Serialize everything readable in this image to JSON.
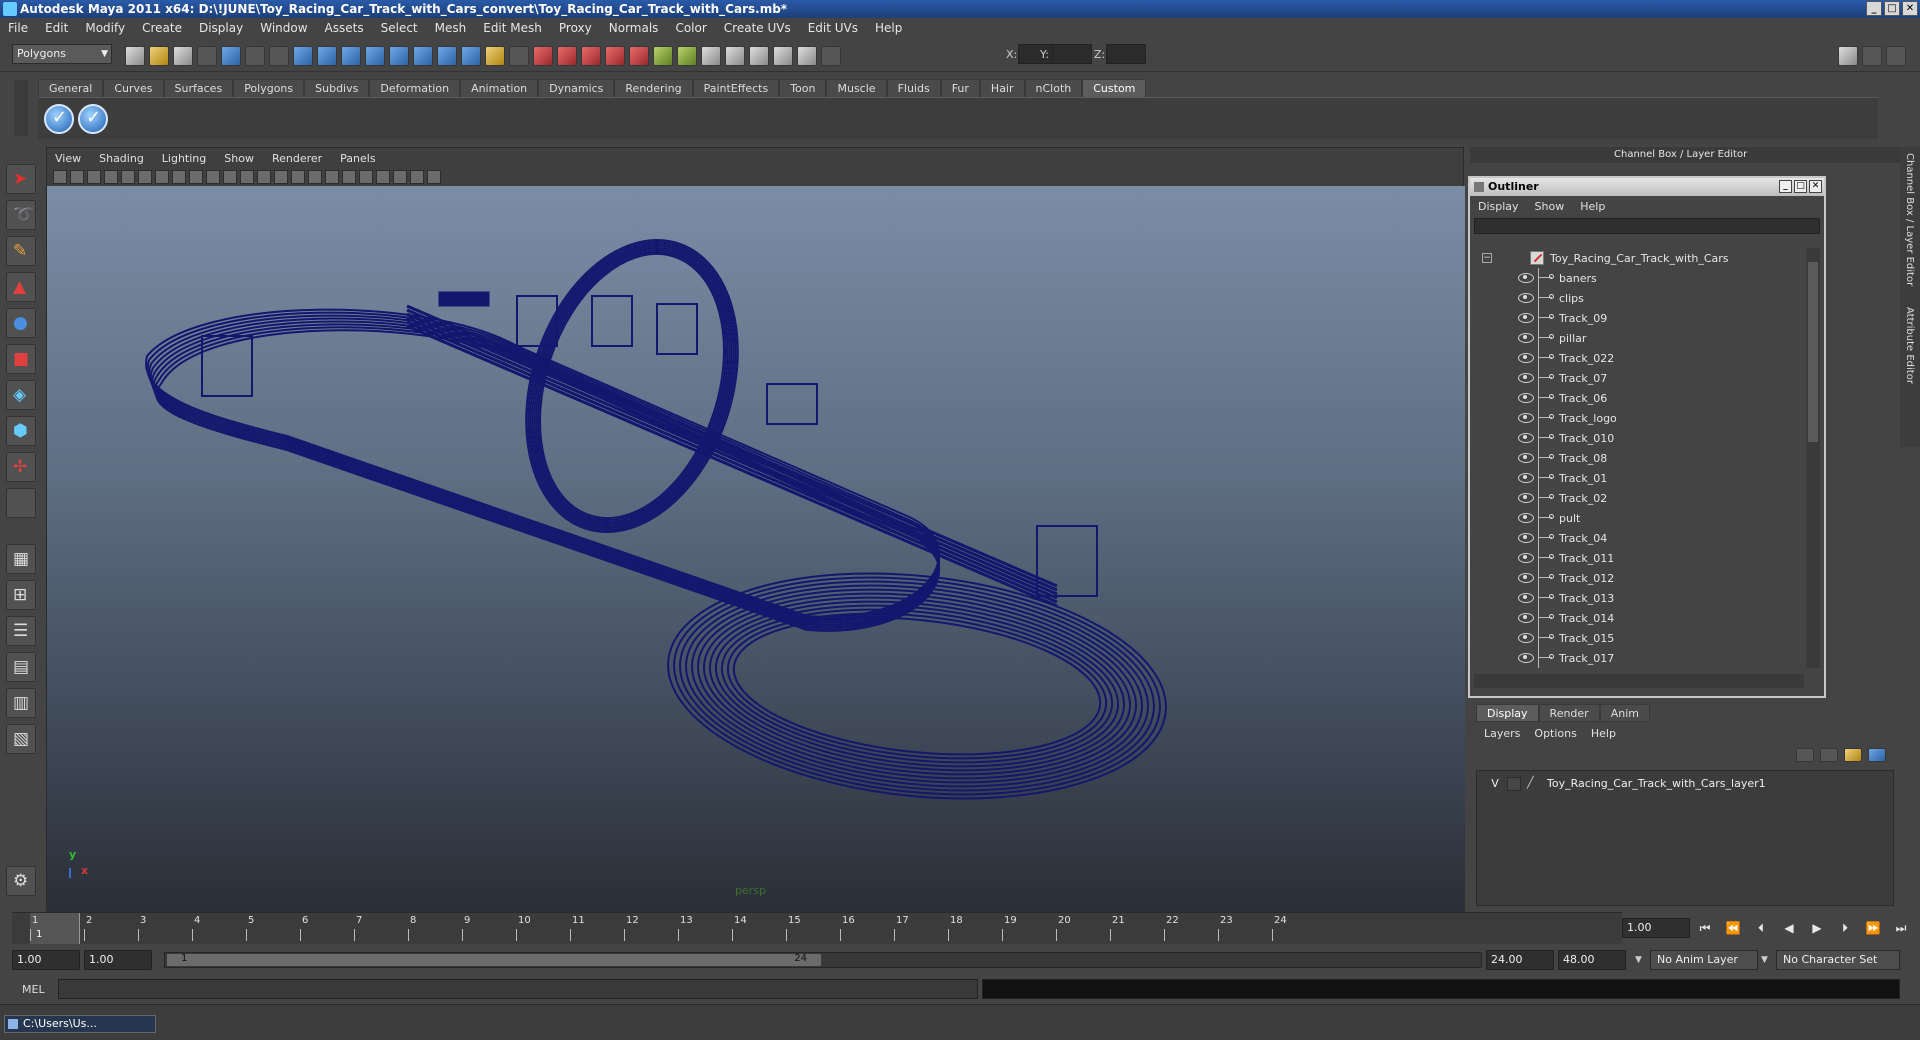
{
  "window": {
    "title": "Autodesk Maya 2011 x64: D:\\!JUNE\\Toy_Racing_Car_Track_with_Cars_convert\\Toy_Racing_Car_Track_with_Cars.mb*",
    "minimize": "_",
    "maximize": "□",
    "close": "✕"
  },
  "menu": [
    "File",
    "Edit",
    "Modify",
    "Create",
    "Display",
    "Window",
    "Assets",
    "Select",
    "Mesh",
    "Edit Mesh",
    "Proxy",
    "Normals",
    "Color",
    "Create UVs",
    "Edit UVs",
    "Help"
  ],
  "status_line": {
    "mode": "Polygons",
    "x_label": "X:",
    "y_label": "Y:",
    "z_label": "Z:"
  },
  "shelf": {
    "tabs": [
      "General",
      "Curves",
      "Surfaces",
      "Polygons",
      "Subdivs",
      "Deformation",
      "Animation",
      "Dynamics",
      "Rendering",
      "PaintEffects",
      "Toon",
      "Muscle",
      "Fluids",
      "Fur",
      "Hair",
      "nCloth",
      "Custom"
    ],
    "active_tab": "Custom"
  },
  "viewport": {
    "menu": [
      "View",
      "Shading",
      "Lighting",
      "Show",
      "Renderer",
      "Panels"
    ],
    "camera": "persp",
    "axis_y": "y",
    "axis_x": "x",
    "wire_color": "#14176e"
  },
  "channel_box": {
    "title": "Channel Box / Layer Editor",
    "side_tabs": [
      "Channel Box / Layer Editor",
      "Attribute Editor"
    ]
  },
  "outliner": {
    "title": "Outliner",
    "menu": [
      "Display",
      "Show",
      "Help"
    ],
    "root": "Toy_Racing_Car_Track_with_Cars",
    "expand_glyph": "−",
    "items": [
      "baners",
      "clips",
      "Track_09",
      "pillar",
      "Track_022",
      "Track_07",
      "Track_06",
      "Track_logo",
      "Track_010",
      "Track_08",
      "Track_01",
      "Track_02",
      "pult",
      "Track_04",
      "Track_011",
      "Track_012",
      "Track_013",
      "Track_014",
      "Track_015",
      "Track_017"
    ]
  },
  "layer_editor": {
    "tabs": [
      "Display",
      "Render",
      "Anim"
    ],
    "active_tab": "Display",
    "menu": [
      "Layers",
      "Options",
      "Help"
    ],
    "layer": {
      "visible": "V",
      "name": "Toy_Racing_Car_Track_with_Cars_layer1"
    }
  },
  "time_slider": {
    "frames": [
      "1",
      "2",
      "3",
      "4",
      "5",
      "6",
      "7",
      "8",
      "9",
      "10",
      "11",
      "12",
      "13",
      "14",
      "15",
      "16",
      "17",
      "18",
      "19",
      "20",
      "21",
      "22",
      "23",
      "24"
    ],
    "current_frame": "1",
    "current_time_field": "1.00",
    "playback_buttons": [
      "⏮",
      "⏪",
      "⏴",
      "◀",
      "▶",
      "⏵",
      "⏩",
      "⏭"
    ]
  },
  "range_slider": {
    "start": "1.00",
    "playback_start": "1.00",
    "range_lo": "1",
    "range_hi": "24",
    "playback_end": "24.00",
    "end": "48.00",
    "anim_layer": "No Anim Layer",
    "character_set": "No Character Set"
  },
  "command_line": {
    "label": "MEL"
  },
  "taskbar": {
    "item": "C:\\Users\\Us..."
  }
}
